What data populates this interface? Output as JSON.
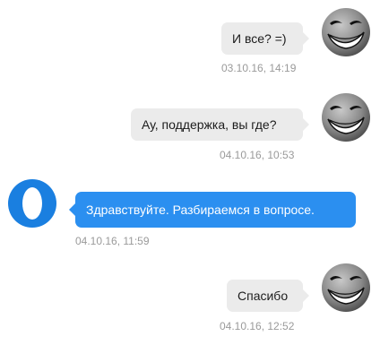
{
  "messages": [
    {
      "text": "И все? =)",
      "time": "03.10.16, 14:19",
      "side": "user"
    },
    {
      "text": "Ау, поддержка, вы где?",
      "time": "04.10.16, 10:53",
      "side": "user"
    },
    {
      "text": "Здравствуйте. Разбираемся в вопросе.",
      "time": "04.10.16, 11:59",
      "side": "support"
    },
    {
      "text": "Спасибо",
      "time": "04.10.16, 12:52",
      "side": "user"
    }
  ],
  "avatars": {
    "user": "trollface-avatar-icon",
    "support": "support-logo-icon"
  },
  "colors": {
    "user_bubble": "#ebebeb",
    "support_bubble": "#2b8ff0",
    "support_logo": "#1a7fe0",
    "timestamp": "#9a9a9a"
  }
}
